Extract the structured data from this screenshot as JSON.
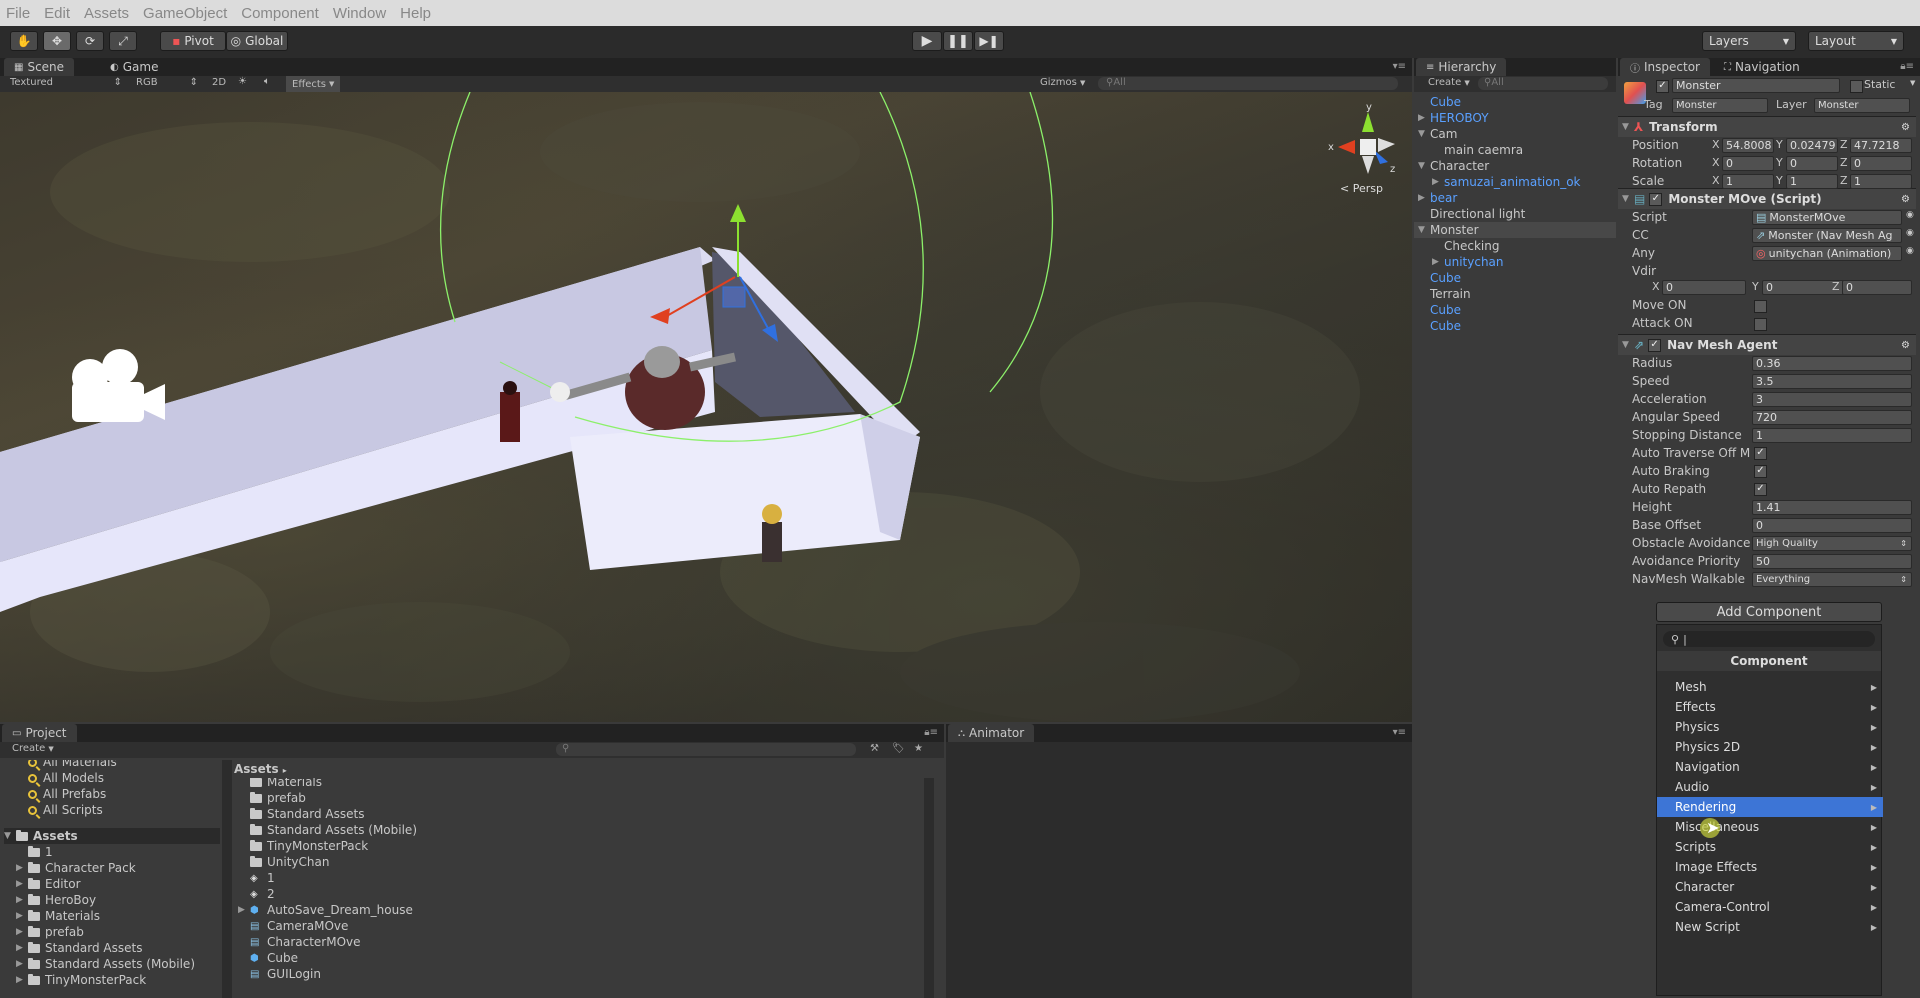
{
  "menubar": {
    "items": [
      "File",
      "Edit",
      "Assets",
      "GameObject",
      "Component",
      "Window",
      "Help"
    ]
  },
  "toolbar": {
    "pivot": "Pivot",
    "global": "Global",
    "layers": "Layers",
    "layout": "Layout"
  },
  "scene": {
    "tabs": [
      "Scene",
      "Game"
    ],
    "shading": "Textured",
    "color": "RGB",
    "mode2d": "2D",
    "effects": "Effects",
    "gizmos": "Gizmos",
    "search": "All",
    "persp": "Persp",
    "gizmo_axes": {
      "y": "y",
      "x": "x",
      "z": "z"
    }
  },
  "hierarchy": {
    "title": "Hierarchy",
    "create": "Create",
    "search": "All",
    "items": [
      {
        "label": "Cube",
        "blue": true,
        "indent": 0,
        "arrow": ""
      },
      {
        "label": "HEROBOY",
        "blue": true,
        "indent": 0,
        "arrow": "right"
      },
      {
        "label": "Cam",
        "blue": false,
        "indent": 0,
        "arrow": "down"
      },
      {
        "label": "main caemra",
        "blue": false,
        "indent": 1,
        "arrow": ""
      },
      {
        "label": "Character",
        "blue": false,
        "indent": 0,
        "arrow": "down"
      },
      {
        "label": "samuzai_animation_ok",
        "blue": true,
        "indent": 1,
        "arrow": "right"
      },
      {
        "label": "bear",
        "blue": true,
        "indent": 0,
        "arrow": "right"
      },
      {
        "label": "Directional light",
        "blue": false,
        "indent": 0,
        "arrow": ""
      },
      {
        "label": "Monster",
        "blue": false,
        "indent": 0,
        "arrow": "down",
        "selected": true
      },
      {
        "label": "Checking",
        "blue": false,
        "indent": 1,
        "arrow": ""
      },
      {
        "label": "unitychan",
        "blue": true,
        "indent": 1,
        "arrow": "right"
      },
      {
        "label": "Cube",
        "blue": true,
        "indent": 0,
        "arrow": ""
      },
      {
        "label": "Terrain",
        "blue": false,
        "indent": 0,
        "arrow": ""
      },
      {
        "label": "Cube",
        "blue": true,
        "indent": 0,
        "arrow": ""
      },
      {
        "label": "Cube",
        "blue": true,
        "indent": 0,
        "arrow": ""
      }
    ]
  },
  "inspector": {
    "tabs": [
      "Inspector",
      "Navigation"
    ],
    "object_name": "Monster",
    "static": "Static",
    "tag_label": "Tag",
    "tag": "Monster",
    "layer_label": "Layer",
    "layer": "Monster",
    "transform": {
      "title": "Transform",
      "position": {
        "label": "Position",
        "x": "54.8008",
        "y": "0.02479",
        "z": "47.7218"
      },
      "rotation": {
        "label": "Rotation",
        "x": "0",
        "y": "0",
        "z": "0"
      },
      "scale": {
        "label": "Scale",
        "x": "1",
        "y": "1",
        "z": "1"
      },
      "axis_x": "X",
      "axis_y": "Y",
      "axis_z": "Z"
    },
    "script_comp": {
      "title": "Monster MOve (Script)",
      "script_label": "Script",
      "script": "MonsterMOve",
      "cc_label": "CC",
      "cc": "Monster (Nav Mesh Ag",
      "any_label": "Any",
      "any": "unitychan (Animation)",
      "vdir_label": "Vdir",
      "vdir": {
        "x": "0",
        "y": "0",
        "z": "0"
      },
      "move_on_label": "Move ON",
      "attack_on_label": "Attack ON"
    },
    "nav_agent": {
      "title": "Nav Mesh Agent",
      "rows": [
        {
          "label": "Radius",
          "value": "0.36"
        },
        {
          "label": "Speed",
          "value": "3.5"
        },
        {
          "label": "Acceleration",
          "value": "3"
        },
        {
          "label": "Angular Speed",
          "value": "720"
        },
        {
          "label": "Stopping Distance",
          "value": "1"
        },
        {
          "label": "Auto Traverse Off Mes",
          "check": true
        },
        {
          "label": "Auto Braking",
          "check": true
        },
        {
          "label": "Auto Repath",
          "check": true
        },
        {
          "label": "Height",
          "value": "1.41"
        },
        {
          "label": "Base Offset",
          "value": "0"
        },
        {
          "label": "Obstacle Avoidance",
          "dropdown": "High Quality"
        },
        {
          "label": "Avoidance Priority",
          "value": "50"
        },
        {
          "label": "NavMesh Walkable",
          "dropdown": "Everything"
        }
      ]
    },
    "add_component": {
      "button": "Add Component",
      "header": "Component",
      "search_value": "|",
      "items": [
        {
          "label": "Mesh"
        },
        {
          "label": "Effects"
        },
        {
          "label": "Physics"
        },
        {
          "label": "Physics 2D"
        },
        {
          "label": "Navigation"
        },
        {
          "label": "Audio"
        },
        {
          "label": "Rendering",
          "selected": true
        },
        {
          "label": "Miscellaneous"
        },
        {
          "label": "Scripts"
        },
        {
          "label": "Image Effects"
        },
        {
          "label": "Character"
        },
        {
          "label": "Camera-Control"
        },
        {
          "label": "New Script"
        }
      ]
    }
  },
  "project": {
    "title": "Project",
    "create": "Create",
    "favorites": [
      "All Materials",
      "All Models",
      "All Prefabs",
      "All Scripts"
    ],
    "tree_root": "Assets",
    "tree": [
      "1",
      "Character Pack",
      "Editor",
      "HeroBoy",
      "Materials",
      "prefab",
      "Standard Assets",
      "Standard Assets (Mobile)",
      "TinyMonsterPack"
    ],
    "breadcrumb": "Assets",
    "assets": [
      {
        "label": "Materials",
        "icon": "folder"
      },
      {
        "label": "prefab",
        "icon": "folder"
      },
      {
        "label": "Standard Assets",
        "icon": "folder"
      },
      {
        "label": "Standard Assets (Mobile)",
        "icon": "folder"
      },
      {
        "label": "TinyMonsterPack",
        "icon": "folder"
      },
      {
        "label": "UnityChan",
        "icon": "folder"
      },
      {
        "label": "1",
        "icon": "unity"
      },
      {
        "label": "2",
        "icon": "unity"
      },
      {
        "label": "AutoSave_Dream_house",
        "icon": "prefab"
      },
      {
        "label": "CameraMOve",
        "icon": "script"
      },
      {
        "label": "CharacterMOve",
        "icon": "script"
      },
      {
        "label": "Cube",
        "icon": "prefab"
      },
      {
        "label": "GUILogin",
        "icon": "script"
      }
    ]
  },
  "animator": {
    "title": "Animator"
  }
}
